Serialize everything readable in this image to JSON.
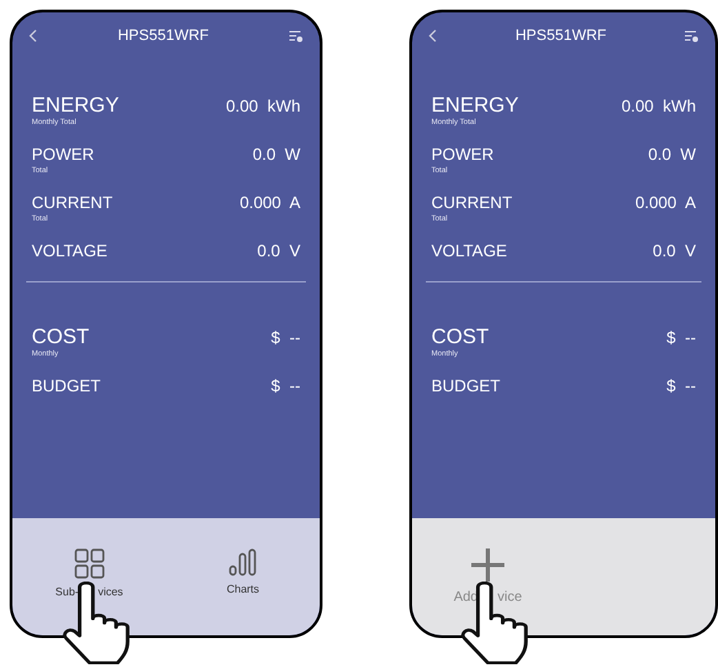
{
  "phones": [
    {
      "title": "HPS551WRF",
      "metrics": [
        {
          "label": "ENERGY",
          "sublabel": "Monthly Total",
          "value": "0.00  kWh",
          "large": true
        },
        {
          "label": "POWER",
          "sublabel": "Total",
          "value": "0.0  W",
          "large": false
        },
        {
          "label": "CURRENT",
          "sublabel": "Total",
          "value": "0.000  A",
          "large": false
        },
        {
          "label": "VOLTAGE",
          "value": "0.0  V",
          "large": false
        }
      ],
      "costs": [
        {
          "label": "COST",
          "sublabel": "Monthly",
          "value": "$  --",
          "large": true
        },
        {
          "label": "BUDGET",
          "value": "$  --",
          "large": false
        }
      ],
      "bottom_bar": {
        "kind": "tabs",
        "items": [
          {
            "kind": "grid",
            "label_parts": [
              "Sub-",
              "vices"
            ],
            "pointer": true
          },
          {
            "kind": "chart",
            "label_parts": [
              "Charts"
            ],
            "pointer": false
          }
        ]
      }
    },
    {
      "title": "HPS551WRF",
      "metrics": [
        {
          "label": "ENERGY",
          "sublabel": "Monthly Total",
          "value": "0.00  kWh",
          "large": true
        },
        {
          "label": "POWER",
          "sublabel": "Total",
          "value": "0.0  W",
          "large": false
        },
        {
          "label": "CURRENT",
          "sublabel": "Total",
          "value": "0.000  A",
          "large": false
        },
        {
          "label": "VOLTAGE",
          "value": "0.0  V",
          "large": false
        }
      ],
      "costs": [
        {
          "label": "COST",
          "sublabel": "Monthly",
          "value": "$  --",
          "large": true
        },
        {
          "label": "BUDGET",
          "value": "$  --",
          "large": false
        }
      ],
      "bottom_bar": {
        "kind": "add",
        "items": [
          {
            "kind": "plus",
            "label_parts": [
              "Add",
              "vice"
            ],
            "pointer": true
          }
        ]
      }
    }
  ]
}
